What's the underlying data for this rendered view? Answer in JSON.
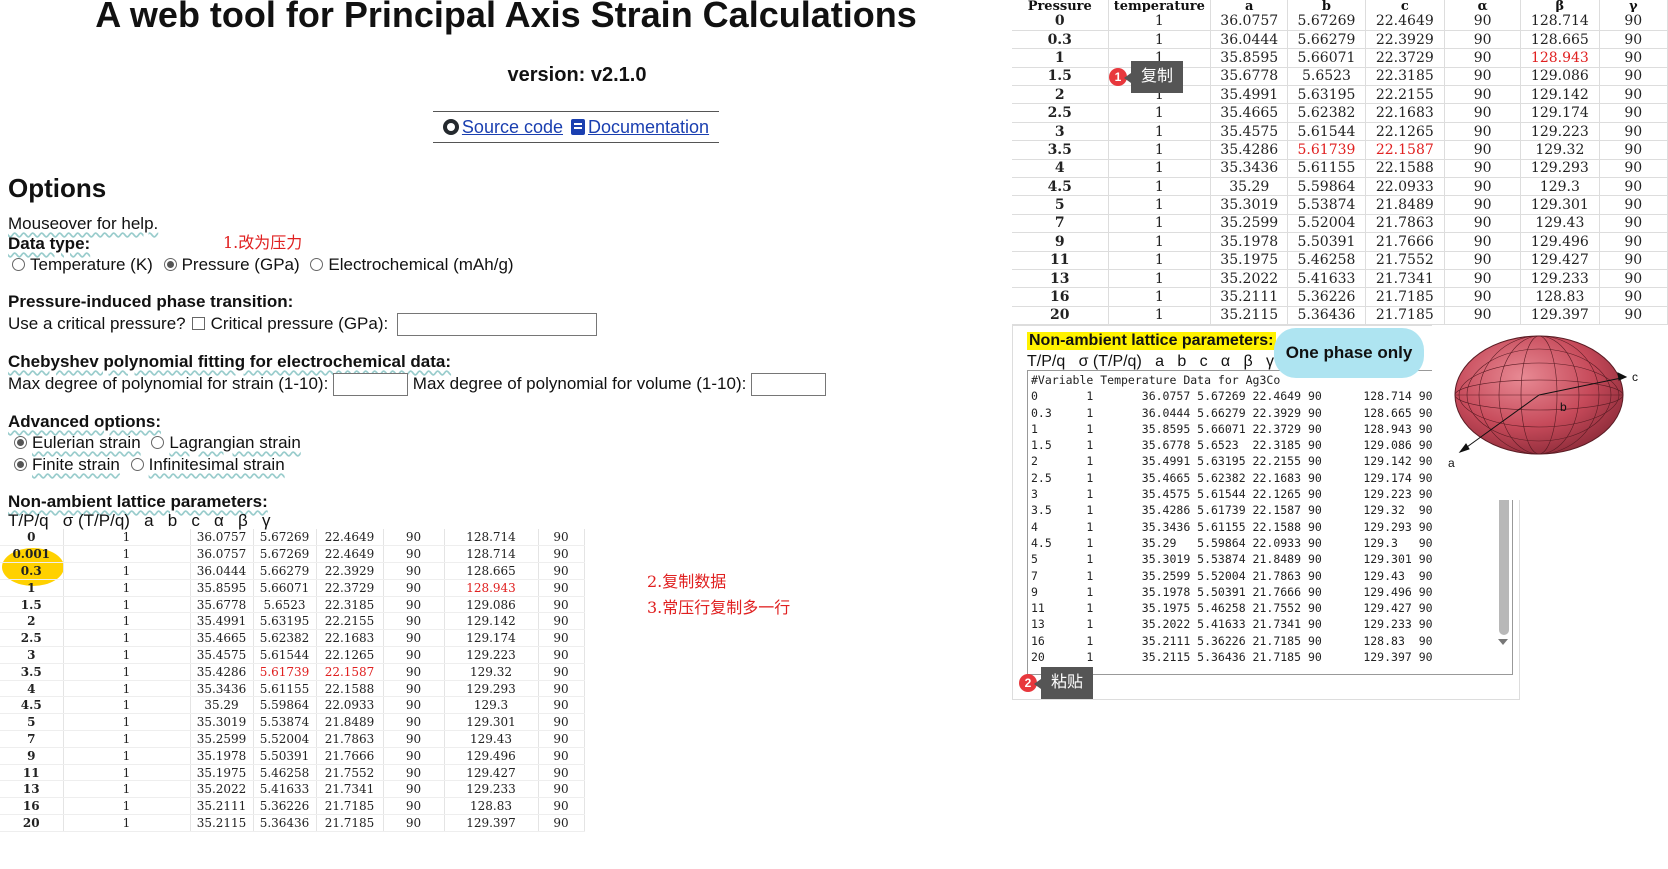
{
  "title": "A web tool for Principal Axis Strain Calculations",
  "version": "version: v2.1.0",
  "links": {
    "source": "Source code",
    "docs": "Documentation"
  },
  "options": {
    "heading": "Options",
    "mouseover": "Mouseover for help.",
    "data_type_label": "Data type:",
    "data_type_options": [
      "Temperature (K)",
      "Pressure (GPa)",
      "Electrochemical (mAh/g)"
    ],
    "data_type_selected": "Pressure (GPa)",
    "phase_heading": "Pressure-induced phase transition:",
    "critical_question": "Use a critical pressure?",
    "critical_label": "Critical pressure (GPa):",
    "cheb_heading": "Chebyshev polynomial fitting for electrochemical data:",
    "cheb_strain_label": "Max degree of polynomial for strain (1-10):",
    "cheb_volume_label": "Max degree of polynomial for volume (1-10):",
    "advanced_heading": "Advanced options:",
    "strain_type": [
      "Eulerian strain",
      "Lagrangian strain"
    ],
    "strain_scale": [
      "Finite strain",
      "Infinitesimal strain"
    ],
    "nalp_heading": "Non-ambient lattice parameters:",
    "nalp_columns": "T/P/q   σ (T/P/q)   a   b   c   α   β   γ"
  },
  "annotations": {
    "note1": "1.改为压力",
    "note2": "2.复制数据",
    "note3": "3.常压行复制多一行",
    "copy_num": "1",
    "copy_tip": "复制",
    "paste_num": "2",
    "paste_tip": "粘贴",
    "one_phase": "One phase only"
  },
  "pasted_rows": [
    [
      "0",
      "1",
      "36.0757",
      "5.67269",
      "22.4649",
      "90",
      "128.714",
      "90"
    ],
    [
      "0.001",
      "1",
      "36.0757",
      "5.67269",
      "22.4649",
      "90",
      "128.714",
      "90"
    ],
    [
      "0.3",
      "1",
      "36.0444",
      "5.66279",
      "22.3929",
      "90",
      "128.665",
      "90"
    ],
    [
      "1",
      "1",
      "35.8595",
      "5.66071",
      "22.3729",
      "90",
      "128.943",
      "90"
    ],
    [
      "1.5",
      "1",
      "35.6778",
      "5.6523",
      "22.3185",
      "90",
      "129.086",
      "90"
    ],
    [
      "2",
      "1",
      "35.4991",
      "5.63195",
      "22.2155",
      "90",
      "129.142",
      "90"
    ],
    [
      "2.5",
      "1",
      "35.4665",
      "5.62382",
      "22.1683",
      "90",
      "129.174",
      "90"
    ],
    [
      "3",
      "1",
      "35.4575",
      "5.61544",
      "22.1265",
      "90",
      "129.223",
      "90"
    ],
    [
      "3.5",
      "1",
      "35.4286",
      "5.61739",
      "22.1587",
      "90",
      "129.32",
      "90"
    ],
    [
      "4",
      "1",
      "35.3436",
      "5.61155",
      "22.1588",
      "90",
      "129.293",
      "90"
    ],
    [
      "4.5",
      "1",
      "35.29",
      "5.59864",
      "22.0933",
      "90",
      "129.3",
      "90"
    ],
    [
      "5",
      "1",
      "35.3019",
      "5.53874",
      "21.8489",
      "90",
      "129.301",
      "90"
    ],
    [
      "7",
      "1",
      "35.2599",
      "5.52004",
      "21.7863",
      "90",
      "129.43",
      "90"
    ],
    [
      "9",
      "1",
      "35.1978",
      "5.50391",
      "21.7666",
      "90",
      "129.496",
      "90"
    ],
    [
      "11",
      "1",
      "35.1975",
      "5.46258",
      "21.7552",
      "90",
      "129.427",
      "90"
    ],
    [
      "13",
      "1",
      "35.2022",
      "5.41633",
      "21.7341",
      "90",
      "129.233",
      "90"
    ],
    [
      "16",
      "1",
      "35.2111",
      "5.36226",
      "21.7185",
      "90",
      "128.83",
      "90"
    ],
    [
      "20",
      "1",
      "35.2115",
      "5.36436",
      "21.7185",
      "90",
      "129.397",
      "90"
    ]
  ],
  "sheet": {
    "headers": [
      "Pressure",
      "temperature",
      "a",
      "b",
      "c",
      "α",
      "β",
      "γ"
    ],
    "rows": [
      [
        "0",
        "1",
        "36.0757",
        "5.67269",
        "22.4649",
        "90",
        "128.714",
        "90"
      ],
      [
        "0.3",
        "1",
        "36.0444",
        "5.66279",
        "22.3929",
        "90",
        "128.665",
        "90"
      ],
      [
        "1",
        "1",
        "35.8595",
        "5.66071",
        "22.3729",
        "90",
        "128.943",
        "90"
      ],
      [
        "1.5",
        "1",
        "35.6778",
        "5.6523",
        "22.3185",
        "90",
        "129.086",
        "90"
      ],
      [
        "2",
        "1",
        "35.4991",
        "5.63195",
        "22.2155",
        "90",
        "129.142",
        "90"
      ],
      [
        "2.5",
        "1",
        "35.4665",
        "5.62382",
        "22.1683",
        "90",
        "129.174",
        "90"
      ],
      [
        "3",
        "1",
        "35.4575",
        "5.61544",
        "22.1265",
        "90",
        "129.223",
        "90"
      ],
      [
        "3.5",
        "1",
        "35.4286",
        "5.61739",
        "22.1587",
        "90",
        "129.32",
        "90"
      ],
      [
        "4",
        "1",
        "35.3436",
        "5.61155",
        "22.1588",
        "90",
        "129.293",
        "90"
      ],
      [
        "4.5",
        "1",
        "35.29",
        "5.59864",
        "22.0933",
        "90",
        "129.3",
        "90"
      ],
      [
        "5",
        "1",
        "35.3019",
        "5.53874",
        "21.8489",
        "90",
        "129.301",
        "90"
      ],
      [
        "7",
        "1",
        "35.2599",
        "5.52004",
        "21.7863",
        "90",
        "129.43",
        "90"
      ],
      [
        "9",
        "1",
        "35.1978",
        "5.50391",
        "21.7666",
        "90",
        "129.496",
        "90"
      ],
      [
        "11",
        "1",
        "35.1975",
        "5.46258",
        "21.7552",
        "90",
        "129.427",
        "90"
      ],
      [
        "13",
        "1",
        "35.2022",
        "5.41633",
        "21.7341",
        "90",
        "129.233",
        "90"
      ],
      [
        "16",
        "1",
        "35.2111",
        "5.36226",
        "21.7185",
        "90",
        "128.83",
        "90"
      ],
      [
        "20",
        "1",
        "35.2115",
        "5.36436",
        "21.7185",
        "90",
        "129.397",
        "90"
      ]
    ]
  },
  "textarea": {
    "header": "#Variable Temperature Data for Ag3Co",
    "rows": [
      "0       1       36.0757 5.67269 22.4649 90      128.714 90",
      "0.3     1       36.0444 5.66279 22.3929 90      128.665 90",
      "1       1       35.8595 5.66071 22.3729 90      128.943 90",
      "1.5     1       35.6778 5.6523  22.3185 90      129.086 90",
      "2       1       35.4991 5.63195 22.2155 90      129.142 90",
      "2.5     1       35.4665 5.62382 22.1683 90      129.174 90",
      "3       1       35.4575 5.61544 22.1265 90      129.223 90",
      "3.5     1       35.4286 5.61739 22.1587 90      129.32  90",
      "4       1       35.3436 5.61155 22.1588 90      129.293 90",
      "4.5     1       35.29   5.59864 22.0933 90      129.3   90",
      "5       1       35.3019 5.53874 21.8489 90      129.301 90",
      "7       1       35.2599 5.52004 21.7863 90      129.43  90",
      "9       1       35.1978 5.50391 21.7666 90      129.496 90",
      "11      1       35.1975 5.46258 21.7552 90      129.427 90",
      "13      1       35.2022 5.41633 21.7341 90      129.233 90",
      "16      1       35.2111 5.36226 21.7185 90      128.83  90",
      "20      1       35.2115 5.36436 21.7185 90      129.397 90"
    ]
  },
  "ellipsoid_axes": {
    "a": "a",
    "b": "b",
    "c": "c"
  },
  "colors": {
    "highlight_red": "#e02020",
    "yellow": "#ffd100",
    "tip_bg": "#555555",
    "bubble": "#aee4f1",
    "ellipsoid": "#c64a5a"
  }
}
